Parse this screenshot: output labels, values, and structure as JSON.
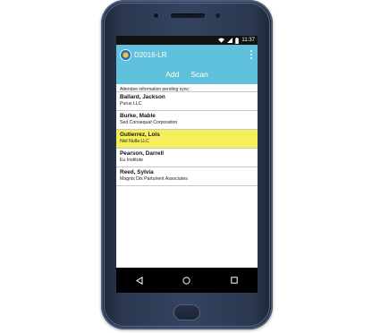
{
  "status_bar": {
    "time": "11:37",
    "icons": [
      "wifi-icon",
      "signal-icon",
      "battery-icon"
    ]
  },
  "app_bar": {
    "title": "D2016-LR",
    "logo_icon": "app-logo-icon",
    "menu_icon": "overflow-menu-icon",
    "actions": {
      "add_label": "Add",
      "scan_label": "Scan"
    },
    "color": "#5fc1dc"
  },
  "list": {
    "header": "Attendee information pending sync:",
    "highlight_color": "#f6ef5a",
    "items": [
      {
        "name": "Ballard, Jackson",
        "company": "Purus LLC",
        "highlighted": false
      },
      {
        "name": "Burke, Mable",
        "company": "Sed Consequat Corporation",
        "highlighted": false
      },
      {
        "name": "Gutierrez, Lois",
        "company": "Nisl Nulla LLC",
        "highlighted": true
      },
      {
        "name": "Pearson, Darrell",
        "company": "Eu Institute",
        "highlighted": false
      },
      {
        "name": "Reed, Sylvia",
        "company": "Magnis Dis Parturient Associates",
        "highlighted": false
      }
    ]
  },
  "nav_bar": {
    "icons": [
      "back-icon",
      "home-icon",
      "recents-icon"
    ]
  }
}
